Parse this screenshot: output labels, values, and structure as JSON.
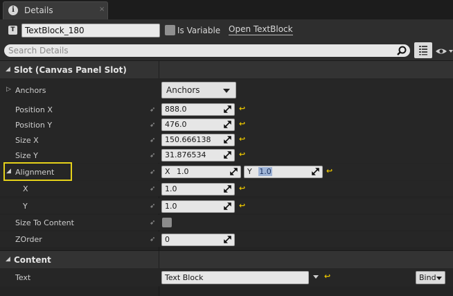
{
  "tab": {
    "icon": "info-icon",
    "icon_glyph": "i",
    "label": "Details",
    "close_glyph": "×"
  },
  "header": {
    "type_icon_glyph": "T",
    "widget_name": "TextBlock_180",
    "is_variable_label": "Is Variable",
    "open_link": "Open TextBlock"
  },
  "search": {
    "placeholder": "Search Details"
  },
  "slot_section": {
    "title": "Slot (Canvas Panel Slot)",
    "rows": {
      "anchors": {
        "label": "Anchors",
        "button": "Anchors"
      },
      "position_x": {
        "label": "Position X",
        "value": "888.0"
      },
      "position_y": {
        "label": "Position Y",
        "value": "476.0"
      },
      "size_x": {
        "label": "Size X",
        "value": "150.666138"
      },
      "size_y": {
        "label": "Size Y",
        "value": "31.876534"
      },
      "alignment": {
        "label": "Alignment",
        "x_prefix": "X",
        "x_value": "1.0",
        "y_prefix": "Y",
        "y_value": "1.0"
      },
      "x": {
        "label": "X",
        "value": "1.0"
      },
      "y": {
        "label": "Y",
        "value": "1.0"
      },
      "size_to_content": {
        "label": "Size To Content",
        "checked": false
      },
      "zorder": {
        "label": "ZOrder",
        "value": "0"
      }
    }
  },
  "content_section": {
    "title": "Content",
    "text": {
      "label": "Text",
      "value": "Text Block",
      "bind_button": "Bind"
    }
  },
  "colors": {
    "highlight": "#e6d21a",
    "reset_arrow": "#e6c200",
    "panel_bg": "#242424"
  }
}
